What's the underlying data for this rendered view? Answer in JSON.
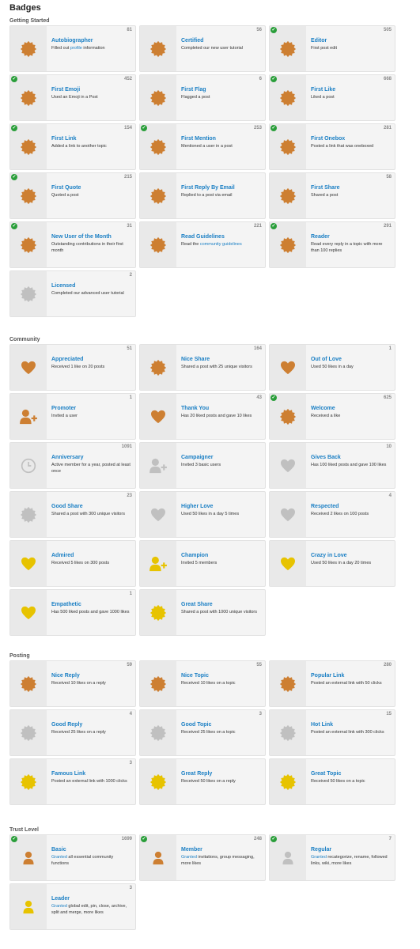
{
  "page_title": "Badges",
  "colors": {
    "bronze": "#cd7f32",
    "silver": "#c0c0c0",
    "gold": "#e7c300",
    "link": "#1a7fc4",
    "check": "#2a9e3a"
  },
  "sections": [
    {
      "title": "Getting Started",
      "badges": [
        {
          "name": "Autobiographer",
          "pre": "Filled out ",
          "link": "profile",
          "post": " information",
          "count": "81",
          "earned": false,
          "icon": "badge-icon",
          "color": "bronze"
        },
        {
          "name": "Certified",
          "pre": "Completed our new user tutorial",
          "link": "",
          "post": "",
          "count": "56",
          "earned": false,
          "icon": "badge-icon",
          "color": "bronze"
        },
        {
          "name": "Editor",
          "pre": "First post edit",
          "link": "",
          "post": "",
          "count": "505",
          "earned": true,
          "icon": "badge-icon",
          "color": "bronze"
        },
        {
          "name": "First Emoji",
          "pre": "Used an Emoji in a Post",
          "link": "",
          "post": "",
          "count": "452",
          "earned": true,
          "icon": "badge-icon",
          "color": "bronze"
        },
        {
          "name": "First Flag",
          "pre": "Flagged a post",
          "link": "",
          "post": "",
          "count": "6",
          "earned": false,
          "icon": "badge-icon",
          "color": "bronze"
        },
        {
          "name": "First Like",
          "pre": "Liked a post",
          "link": "",
          "post": "",
          "count": "668",
          "earned": true,
          "icon": "badge-icon",
          "color": "bronze"
        },
        {
          "name": "First Link",
          "pre": "Added a link to another topic",
          "link": "",
          "post": "",
          "count": "154",
          "earned": true,
          "icon": "badge-icon",
          "color": "bronze"
        },
        {
          "name": "First Mention",
          "pre": "Mentioned a user in a post",
          "link": "",
          "post": "",
          "count": "253",
          "earned": true,
          "icon": "badge-icon",
          "color": "bronze"
        },
        {
          "name": "First Onebox",
          "pre": "Posted a link that was oneboxed",
          "link": "",
          "post": "",
          "count": "281",
          "earned": true,
          "icon": "badge-icon",
          "color": "bronze"
        },
        {
          "name": "First Quote",
          "pre": "Quoted a post",
          "link": "",
          "post": "",
          "count": "215",
          "earned": true,
          "icon": "badge-icon",
          "color": "bronze"
        },
        {
          "name": "First Reply By Email",
          "pre": "Replied to a post via email",
          "link": "",
          "post": "",
          "count": "",
          "earned": false,
          "icon": "badge-icon",
          "color": "bronze"
        },
        {
          "name": "First Share",
          "pre": "Shared a post",
          "link": "",
          "post": "",
          "count": "58",
          "earned": false,
          "icon": "badge-icon",
          "color": "bronze"
        },
        {
          "name": "New User of the Month",
          "pre": "Outstanding contributions in their first month",
          "link": "",
          "post": "",
          "count": "31",
          "earned": true,
          "icon": "badge-icon",
          "color": "bronze"
        },
        {
          "name": "Read Guidelines",
          "pre": "Read the ",
          "link": "community guidelines",
          "post": "",
          "count": "221",
          "earned": false,
          "icon": "badge-icon",
          "color": "bronze"
        },
        {
          "name": "Reader",
          "pre": "Read every reply in a topic with more than 100 replies",
          "link": "",
          "post": "",
          "count": "291",
          "earned": true,
          "icon": "badge-icon",
          "color": "bronze"
        },
        {
          "name": "Licensed",
          "pre": "Completed our advanced user tutorial",
          "link": "",
          "post": "",
          "count": "2",
          "earned": false,
          "icon": "badge-icon",
          "color": "silver"
        }
      ]
    },
    {
      "title": "Community",
      "badges": [
        {
          "name": "Appreciated",
          "pre": "Received 1 like on 20 posts",
          "link": "",
          "post": "",
          "count": "51",
          "earned": false,
          "icon": "heart-icon",
          "color": "bronze"
        },
        {
          "name": "Nice Share",
          "pre": "Shared a post with 25 unique visitors",
          "link": "",
          "post": "",
          "count": "164",
          "earned": false,
          "icon": "badge-icon",
          "color": "bronze"
        },
        {
          "name": "Out of Love",
          "pre": "Used 50 likes in a day",
          "link": "",
          "post": "",
          "count": "1",
          "earned": false,
          "icon": "heart-icon",
          "color": "bronze"
        },
        {
          "name": "Promoter",
          "pre": "Invited a user",
          "link": "",
          "post": "",
          "count": "1",
          "earned": false,
          "icon": "user-plus-icon",
          "color": "bronze"
        },
        {
          "name": "Thank You",
          "pre": "Has 20 liked posts and gave 10 likes",
          "link": "",
          "post": "",
          "count": "43",
          "earned": false,
          "icon": "heart-icon",
          "color": "bronze"
        },
        {
          "name": "Welcome",
          "pre": "Received a like",
          "link": "",
          "post": "",
          "count": "625",
          "earned": true,
          "icon": "badge-icon",
          "color": "bronze"
        },
        {
          "name": "Anniversary",
          "pre": "Active member for a year, posted at least once",
          "link": "",
          "post": "",
          "count": "1091",
          "earned": false,
          "icon": "clock-icon",
          "color": "silver"
        },
        {
          "name": "Campaigner",
          "pre": "Invited 3 basic users",
          "link": "",
          "post": "",
          "count": "",
          "earned": false,
          "icon": "user-plus-icon",
          "color": "silver"
        },
        {
          "name": "Gives Back",
          "pre": "Has 100 liked posts and gave 100 likes",
          "link": "",
          "post": "",
          "count": "10",
          "earned": false,
          "icon": "heart-icon",
          "color": "silver"
        },
        {
          "name": "Good Share",
          "pre": "Shared a post with 300 unique visitors",
          "link": "",
          "post": "",
          "count": "23",
          "earned": false,
          "icon": "badge-icon",
          "color": "silver"
        },
        {
          "name": "Higher Love",
          "pre": "Used 50 likes in a day 5 times",
          "link": "",
          "post": "",
          "count": "",
          "earned": false,
          "icon": "heart-icon",
          "color": "silver"
        },
        {
          "name": "Respected",
          "pre": "Received 2 likes on 100 posts",
          "link": "",
          "post": "",
          "count": "4",
          "earned": false,
          "icon": "heart-icon",
          "color": "silver"
        },
        {
          "name": "Admired",
          "pre": "Received 5 likes on 300 posts",
          "link": "",
          "post": "",
          "count": "",
          "earned": false,
          "icon": "heart-icon",
          "color": "gold"
        },
        {
          "name": "Champion",
          "pre": "Invited 5 members",
          "link": "",
          "post": "",
          "count": "",
          "earned": false,
          "icon": "user-plus-icon",
          "color": "gold"
        },
        {
          "name": "Crazy in Love",
          "pre": "Used 50 likes in a day 20 times",
          "link": "",
          "post": "",
          "count": "",
          "earned": false,
          "icon": "heart-icon",
          "color": "gold"
        },
        {
          "name": "Empathetic",
          "pre": "Has 500 liked posts and gave 1000 likes",
          "link": "",
          "post": "",
          "count": "1",
          "earned": false,
          "icon": "heart-icon",
          "color": "gold"
        },
        {
          "name": "Great Share",
          "pre": "Shared a post with 1000 unique visitors",
          "link": "",
          "post": "",
          "count": "",
          "earned": false,
          "icon": "badge-icon",
          "color": "gold"
        }
      ]
    },
    {
      "title": "Posting",
      "badges": [
        {
          "name": "Nice Reply",
          "pre": "Received 10 likes on a reply",
          "link": "",
          "post": "",
          "count": "59",
          "earned": false,
          "icon": "badge-icon",
          "color": "bronze"
        },
        {
          "name": "Nice Topic",
          "pre": "Received 10 likes on a topic",
          "link": "",
          "post": "",
          "count": "55",
          "earned": false,
          "icon": "badge-icon",
          "color": "bronze"
        },
        {
          "name": "Popular Link",
          "pre": "Posted an external link with 50 clicks",
          "link": "",
          "post": "",
          "count": "280",
          "earned": false,
          "icon": "badge-icon",
          "color": "bronze"
        },
        {
          "name": "Good Reply",
          "pre": "Received 25 likes on a reply",
          "link": "",
          "post": "",
          "count": "4",
          "earned": false,
          "icon": "badge-icon",
          "color": "silver"
        },
        {
          "name": "Good Topic",
          "pre": "Received 25 likes on a topic",
          "link": "",
          "post": "",
          "count": "3",
          "earned": false,
          "icon": "badge-icon",
          "color": "silver"
        },
        {
          "name": "Hot Link",
          "pre": "Posted an external link with 300 clicks",
          "link": "",
          "post": "",
          "count": "15",
          "earned": false,
          "icon": "badge-icon",
          "color": "silver"
        },
        {
          "name": "Famous Link",
          "pre": "Posted an external link with 1000 clicks",
          "link": "",
          "post": "",
          "count": "3",
          "earned": false,
          "icon": "badge-icon",
          "color": "gold"
        },
        {
          "name": "Great Reply",
          "pre": "Received 50 likes on a reply",
          "link": "",
          "post": "",
          "count": "",
          "earned": false,
          "icon": "badge-icon",
          "color": "gold"
        },
        {
          "name": "Great Topic",
          "pre": "Received 50 likes on a topic",
          "link": "",
          "post": "",
          "count": "",
          "earned": false,
          "icon": "badge-icon",
          "color": "gold"
        }
      ]
    },
    {
      "title": "Trust Level",
      "badges": [
        {
          "name": "Basic",
          "pre": "",
          "link": "Granted",
          "post": " all essential community functions",
          "count": "1699",
          "earned": true,
          "icon": "user-icon",
          "color": "bronze"
        },
        {
          "name": "Member",
          "pre": "",
          "link": "Granted",
          "post": " invitations, group messaging, more likes",
          "count": "248",
          "earned": true,
          "icon": "user-icon",
          "color": "bronze"
        },
        {
          "name": "Regular",
          "pre": "",
          "link": "Granted",
          "post": " recategorize, rename, followed links, wiki, more likes",
          "count": "7",
          "earned": true,
          "icon": "user-icon",
          "color": "silver"
        },
        {
          "name": "Leader",
          "pre": "",
          "link": "Granted",
          "post": " global edit, pin, close, archive, split and merge, more likes",
          "count": "3",
          "earned": false,
          "icon": "user-icon",
          "color": "gold"
        }
      ]
    }
  ]
}
